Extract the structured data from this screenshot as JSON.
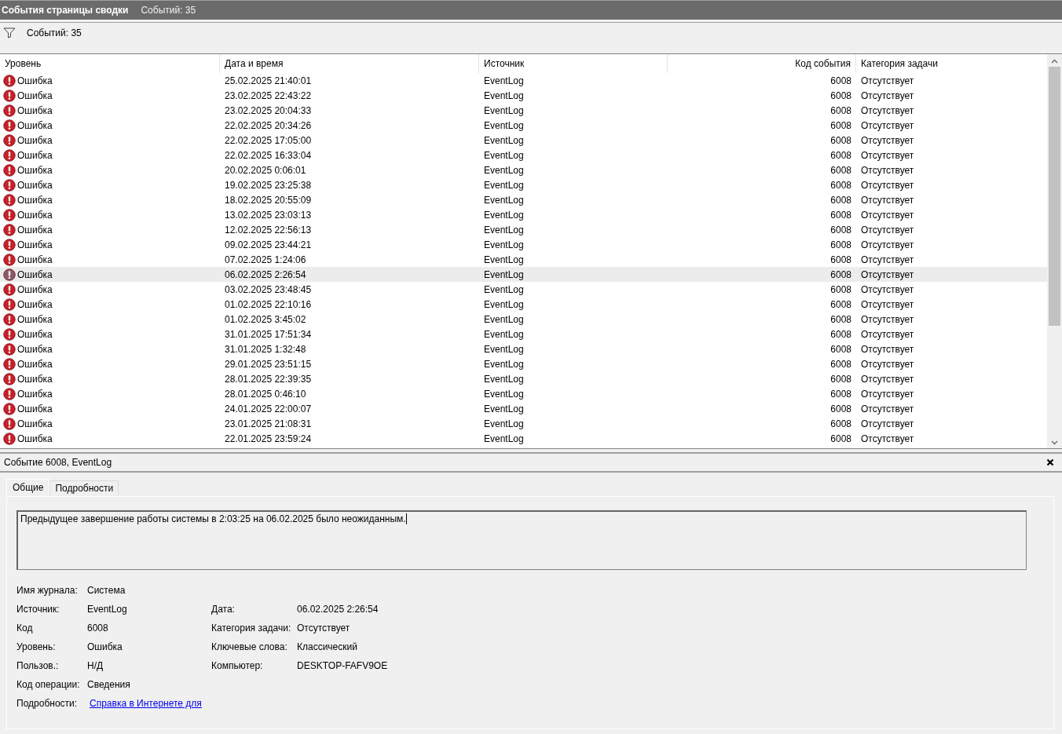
{
  "title_bar": {
    "title": "События страницы сводки",
    "count": "Событий: 35"
  },
  "filter_bar": {
    "count": "Событий: 35"
  },
  "table": {
    "columns": [
      "Уровень",
      "Дата и время",
      "Источник",
      "Код события",
      "Категория задачи"
    ],
    "rows": [
      {
        "level": "Ошибка",
        "datetime": "25.02.2025 21:40:01",
        "source": "EventLog",
        "code": "6008",
        "category": "Отсутствует",
        "selected": false
      },
      {
        "level": "Ошибка",
        "datetime": "23.02.2025 22:43:22",
        "source": "EventLog",
        "code": "6008",
        "category": "Отсутствует",
        "selected": false
      },
      {
        "level": "Ошибка",
        "datetime": "23.02.2025 20:04:33",
        "source": "EventLog",
        "code": "6008",
        "category": "Отсутствует",
        "selected": false
      },
      {
        "level": "Ошибка",
        "datetime": "22.02.2025 20:34:26",
        "source": "EventLog",
        "code": "6008",
        "category": "Отсутствует",
        "selected": false
      },
      {
        "level": "Ошибка",
        "datetime": "22.02.2025 17:05:00",
        "source": "EventLog",
        "code": "6008",
        "category": "Отсутствует",
        "selected": false
      },
      {
        "level": "Ошибка",
        "datetime": "22.02.2025 16:33:04",
        "source": "EventLog",
        "code": "6008",
        "category": "Отсутствует",
        "selected": false
      },
      {
        "level": "Ошибка",
        "datetime": "20.02.2025 0:06:01",
        "source": "EventLog",
        "code": "6008",
        "category": "Отсутствует",
        "selected": false
      },
      {
        "level": "Ошибка",
        "datetime": "19.02.2025 23:25:38",
        "source": "EventLog",
        "code": "6008",
        "category": "Отсутствует",
        "selected": false
      },
      {
        "level": "Ошибка",
        "datetime": "18.02.2025 20:55:09",
        "source": "EventLog",
        "code": "6008",
        "category": "Отсутствует",
        "selected": false
      },
      {
        "level": "Ошибка",
        "datetime": "13.02.2025 23:03:13",
        "source": "EventLog",
        "code": "6008",
        "category": "Отсутствует",
        "selected": false
      },
      {
        "level": "Ошибка",
        "datetime": "12.02.2025 22:56:13",
        "source": "EventLog",
        "code": "6008",
        "category": "Отсутствует",
        "selected": false
      },
      {
        "level": "Ошибка",
        "datetime": "09.02.2025 23:44:21",
        "source": "EventLog",
        "code": "6008",
        "category": "Отсутствует",
        "selected": false
      },
      {
        "level": "Ошибка",
        "datetime": "07.02.2025 1:24:06",
        "source": "EventLog",
        "code": "6008",
        "category": "Отсутствует",
        "selected": false
      },
      {
        "level": "Ошибка",
        "datetime": "06.02.2025 2:26:54",
        "source": "EventLog",
        "code": "6008",
        "category": "Отсутствует",
        "selected": true
      },
      {
        "level": "Ошибка",
        "datetime": "03.02.2025 23:48:45",
        "source": "EventLog",
        "code": "6008",
        "category": "Отсутствует",
        "selected": false
      },
      {
        "level": "Ошибка",
        "datetime": "01.02.2025 22:10:16",
        "source": "EventLog",
        "code": "6008",
        "category": "Отсутствует",
        "selected": false
      },
      {
        "level": "Ошибка",
        "datetime": "01.02.2025 3:45:02",
        "source": "EventLog",
        "code": "6008",
        "category": "Отсутствует",
        "selected": false
      },
      {
        "level": "Ошибка",
        "datetime": "31.01.2025 17:51:34",
        "source": "EventLog",
        "code": "6008",
        "category": "Отсутствует",
        "selected": false
      },
      {
        "level": "Ошибка",
        "datetime": "31.01.2025 1:32:48",
        "source": "EventLog",
        "code": "6008",
        "category": "Отсутствует",
        "selected": false
      },
      {
        "level": "Ошибка",
        "datetime": "29.01.2025 23:51:15",
        "source": "EventLog",
        "code": "6008",
        "category": "Отсутствует",
        "selected": false
      },
      {
        "level": "Ошибка",
        "datetime": "28.01.2025 22:39:35",
        "source": "EventLog",
        "code": "6008",
        "category": "Отсутствует",
        "selected": false
      },
      {
        "level": "Ошибка",
        "datetime": "28.01.2025 0:46:10",
        "source": "EventLog",
        "code": "6008",
        "category": "Отсутствует",
        "selected": false
      },
      {
        "level": "Ошибка",
        "datetime": "24.01.2025 22:00:07",
        "source": "EventLog",
        "code": "6008",
        "category": "Отсутствует",
        "selected": false
      },
      {
        "level": "Ошибка",
        "datetime": "23.01.2025 21:08:31",
        "source": "EventLog",
        "code": "6008",
        "category": "Отсутствует",
        "selected": false
      },
      {
        "level": "Ошибка",
        "datetime": "22.01.2025 23:59:24",
        "source": "EventLog",
        "code": "6008",
        "category": "Отсутствует",
        "selected": false
      }
    ]
  },
  "details": {
    "title": "Событие 6008, EventLog",
    "tabs": [
      {
        "label": "Общие",
        "selected": true
      },
      {
        "label": "Подробности",
        "selected": false
      }
    ],
    "message": "Предыдущее завершение работы системы в 2:03:25 на 06.02.2025 было неожиданным.",
    "left_fields": [
      {
        "label": "Имя журнала:",
        "value": "Система"
      },
      {
        "label": "Источник:",
        "value": "EventLog"
      },
      {
        "label": "Код",
        "value": "6008"
      },
      {
        "label": "Уровень:",
        "value": "Ошибка"
      },
      {
        "label": "Пользов.:",
        "value": "Н/Д"
      },
      {
        "label": "Код операции:",
        "value": "Сведения"
      }
    ],
    "right_fields": [
      {
        "label": "Дата:",
        "value": "06.02.2025 2:26:54"
      },
      {
        "label": "Категория задачи:",
        "value": "Отсутствует"
      },
      {
        "label": "Ключевые слова:",
        "value": "Классический"
      },
      {
        "label": "Компьютер:",
        "value": "DESKTOP-FAFV9OE"
      }
    ],
    "more": {
      "label": "Подробности:",
      "link": "Справка в Интернете для "
    }
  }
}
